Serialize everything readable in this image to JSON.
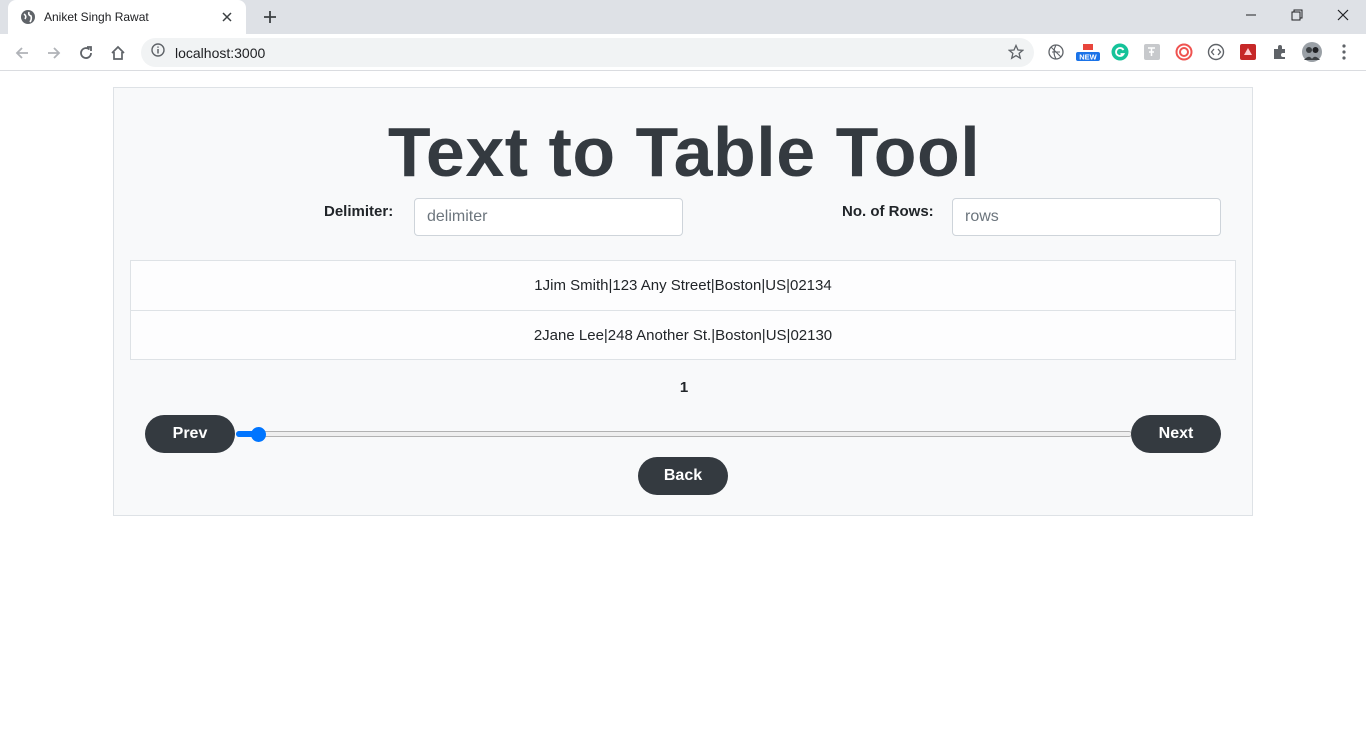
{
  "browser": {
    "tab_title": "Aniket Singh Rawat",
    "url": "localhost:3000",
    "extensions": [
      "globe-crossed-icon",
      "new-badge-icon",
      "grammarly-icon",
      "translate-icon",
      "spiral-icon",
      "code-icon",
      "red-square-icon",
      "puzzle-icon",
      "avatar",
      "menu-dots-icon"
    ]
  },
  "page": {
    "title": "Text to Table Tool",
    "delimiter_label": "Delimiter:",
    "delimiter_placeholder": "delimiter",
    "rows_label": "No. of Rows:",
    "rows_placeholder": "rows",
    "list": [
      "1Jim Smith|123 Any Street|Boston|US|02134",
      "2Jane Lee|248 Another St.|Boston|US|02130"
    ],
    "page_number": "1",
    "prev_label": "Prev",
    "next_label": "Next",
    "back_label": "Back",
    "slider_value": 0.025
  },
  "colors": {
    "accent": "#0075ff",
    "dark": "#343a40"
  }
}
